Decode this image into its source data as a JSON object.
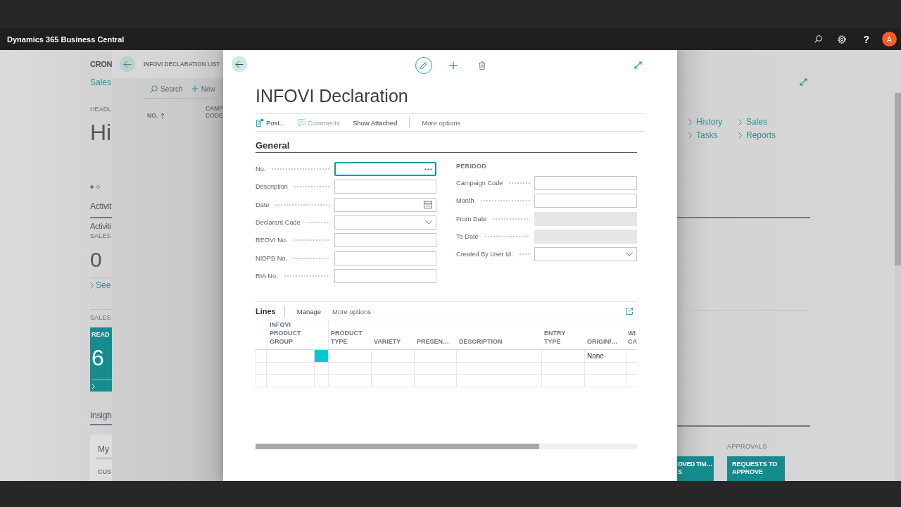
{
  "app_bar": {
    "title": "Dynamics 365 Business Central",
    "help": "?",
    "avatar_initial": "A"
  },
  "role_center": {
    "company": "CRON",
    "role_link": "Sales",
    "headline_caption": "HEADL",
    "headline": "Hi",
    "carousel": [
      {
        "selected": true
      },
      {
        "selected": false
      }
    ],
    "activities": {
      "title": "Activit",
      "subtitle": "Activiti",
      "caption": "SALES",
      "value": "0",
      "link": "See"
    },
    "sales": {
      "caption": "SALES",
      "tile_label": "READ",
      "tile_value": "6"
    },
    "insights": {
      "title": "Insigh",
      "tab": "My",
      "column": "CUS"
    },
    "links": [
      {
        "label": "History"
      },
      {
        "label": "Sales"
      },
      {
        "label": "Tasks"
      },
      {
        "label": "Reports"
      }
    ],
    "tile_groups": [
      {
        "tiles": [
          {
            "label": "OVED TIM… S"
          }
        ]
      },
      {
        "caption": "APPROVALS",
        "tiles": [
          {
            "label": "REQUESTS TO APPROVE"
          }
        ]
      }
    ]
  },
  "list_page": {
    "title": "INFOVI DECLARATION LIST",
    "actions": [
      {
        "label": "Search",
        "kind": "search"
      },
      {
        "label": "New",
        "kind": "new"
      }
    ],
    "columns": [
      {
        "label": "NO.",
        "sorted": true
      },
      {
        "label": "CAMP CODE",
        "sorted": false
      }
    ]
  },
  "dialog": {
    "title": "INFOVI Declaration",
    "actions": [
      {
        "label": "Post...",
        "kind": "post",
        "disabled": false
      },
      {
        "label": "Comments",
        "kind": "comments",
        "disabled": true
      },
      {
        "label": "Show Attached",
        "kind": "plain",
        "disabled": false
      },
      {
        "label": "More options",
        "kind": "overflow",
        "disabled": false
      }
    ],
    "general": {
      "title": "General",
      "fields": [
        {
          "label": "No.",
          "kind": "assist",
          "focused": true,
          "disabled": false
        },
        {
          "label": "Description",
          "kind": "text",
          "focused": false,
          "disabled": false
        },
        {
          "label": "Date",
          "kind": "date",
          "focused": false,
          "disabled": false
        },
        {
          "label": "Declarant Code",
          "kind": "dropdown",
          "focused": false,
          "disabled": false
        },
        {
          "label": "REOVI No.",
          "kind": "text",
          "focused": false,
          "disabled": false
        },
        {
          "label": "NIDPB No.",
          "kind": "text",
          "focused": false,
          "disabled": false
        },
        {
          "label": "RIA No.",
          "kind": "text",
          "focused": false,
          "disabled": false
        }
      ],
      "period": {
        "title": "PERIDOD",
        "fields": [
          {
            "label": "Campaign Code",
            "kind": "text",
            "focused": false,
            "disabled": false
          },
          {
            "label": "Month",
            "kind": "text",
            "focused": false,
            "disabled": false
          },
          {
            "label": "From Date",
            "kind": "text",
            "focused": false,
            "disabled": true
          },
          {
            "label": "To Date",
            "kind": "text",
            "focused": false,
            "disabled": true
          },
          {
            "label": "Created By User Id.",
            "kind": "dropdown",
            "focused": false,
            "disabled": false
          }
        ]
      }
    },
    "lines": {
      "title": "Lines",
      "actions": [
        {
          "label": "Manage",
          "kind": "plain"
        },
        {
          "label": "More options",
          "kind": "overflow"
        }
      ],
      "columns": [
        {
          "label": "INFOVI PRODUCT GROUP"
        },
        {
          "label": "PRODUCT TYPE"
        },
        {
          "label": "VARIETY"
        },
        {
          "label": "PRESEN…"
        },
        {
          "label": "DESCRIPTION"
        },
        {
          "label": "ENTRY TYPE"
        },
        {
          "label": "ORIGIN/…"
        },
        {
          "label": "WI CA"
        }
      ],
      "rows": [
        {
          "selected": true,
          "cells": [
            null,
            null,
            null,
            null,
            null,
            null,
            "None",
            null
          ]
        },
        {
          "selected": false
        },
        {
          "selected": false
        }
      ]
    }
  }
}
